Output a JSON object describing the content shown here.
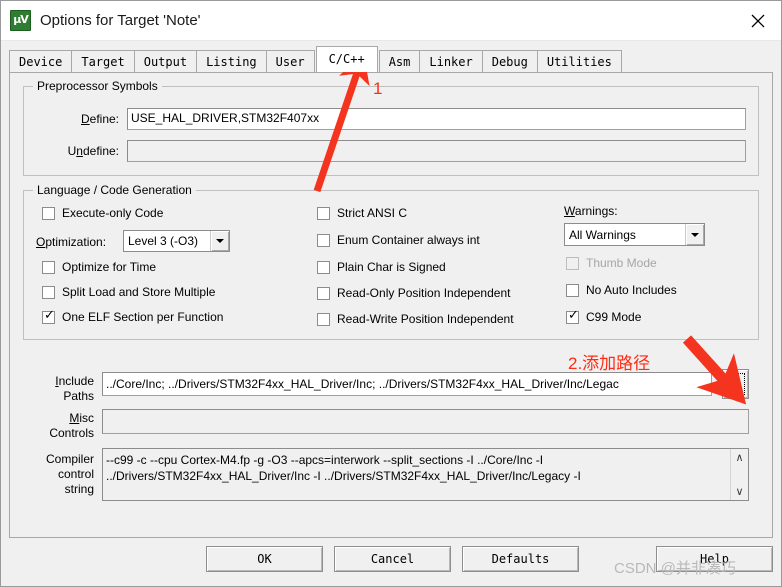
{
  "window": {
    "title": "Options for Target 'Note'",
    "app_icon": "uvision-icon",
    "close_label": "✕"
  },
  "tabs": [
    {
      "label": "Device",
      "selected": false
    },
    {
      "label": "Target",
      "selected": false
    },
    {
      "label": "Output",
      "selected": false
    },
    {
      "label": "Listing",
      "selected": false
    },
    {
      "label": "User",
      "selected": false
    },
    {
      "label": "C/C++",
      "selected": true
    },
    {
      "label": "Asm",
      "selected": false
    },
    {
      "label": "Linker",
      "selected": false
    },
    {
      "label": "Debug",
      "selected": false
    },
    {
      "label": "Utilities",
      "selected": false
    }
  ],
  "preprocessor": {
    "group_title": "Preprocessor Symbols",
    "define_label": "Define:",
    "define_value": "USE_HAL_DRIVER,STM32F407xx",
    "undefine_label": "Undefine:",
    "undefine_value": ""
  },
  "language": {
    "group_title": "Language / Code Generation",
    "left_checkboxes": [
      {
        "label": "Execute-only Code",
        "checked": false,
        "disabled": false
      },
      {
        "label": "Optimize for Time",
        "checked": false,
        "disabled": false
      },
      {
        "label": "Split Load and Store Multiple",
        "checked": false,
        "disabled": false
      },
      {
        "label": "One ELF Section per Function",
        "checked": true,
        "disabled": false
      }
    ],
    "optimization_label": "Optimization:",
    "optimization_value": "Level 3 (-O3)",
    "middle_checkboxes": [
      {
        "label": "Strict ANSI C",
        "checked": false,
        "disabled": false
      },
      {
        "label": "Enum Container always int",
        "checked": false,
        "disabled": false
      },
      {
        "label": "Plain Char is Signed",
        "checked": false,
        "disabled": false
      },
      {
        "label": "Read-Only Position Independent",
        "checked": false,
        "disabled": false
      },
      {
        "label": "Read-Write Position Independent",
        "checked": false,
        "disabled": false
      }
    ],
    "warnings_label": "Warnings:",
    "warnings_value": "All Warnings",
    "right_checkboxes": [
      {
        "label": "Thumb Mode",
        "checked": false,
        "disabled": true
      },
      {
        "label": "No Auto Includes",
        "checked": false,
        "disabled": false
      },
      {
        "label": "C99 Mode",
        "checked": true,
        "disabled": false
      }
    ]
  },
  "paths": {
    "include_label_line1": "Include",
    "include_label_line2": "Paths",
    "include_value": "../Core/Inc;  ../Drivers/STM32F4xx_HAL_Driver/Inc;  ../Drivers/STM32F4xx_HAL_Driver/Inc/Legac",
    "misc_label_line1": "Misc",
    "misc_label_line2": "Controls",
    "misc_value": "",
    "browse_button_name": "browse-ellipsis"
  },
  "compiler": {
    "label_line1": "Compiler",
    "label_line2": "control",
    "label_line3": "string",
    "value": "--c99 -c --cpu Cortex-M4.fp -g -O3 --apcs=interwork --split_sections -I ../Core/Inc -I\n../Drivers/STM32F4xx_HAL_Driver/Inc -I ../Drivers/STM32F4xx_HAL_Driver/Inc/Legacy -I",
    "scroll_up": "∧",
    "scroll_down": "∨"
  },
  "buttons": {
    "ok": "OK",
    "cancel": "Cancel",
    "defaults": "Defaults",
    "help": "Help"
  },
  "annotations": {
    "step1": "1",
    "step2": "2.添加路径",
    "arrow_color": "#f4341f"
  },
  "watermark": "CSDN @并非凑巧"
}
